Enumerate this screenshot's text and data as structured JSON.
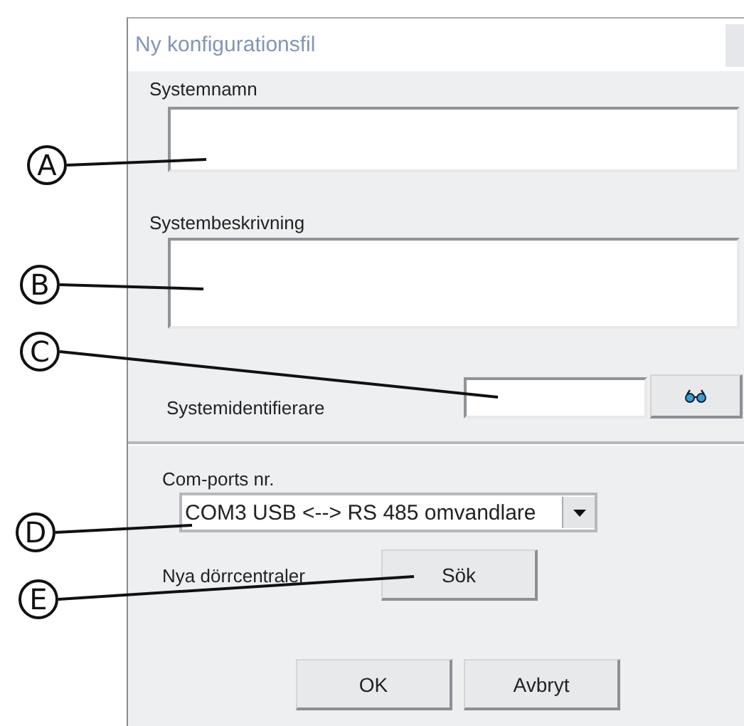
{
  "window": {
    "title": "Ny konfigurationsfil"
  },
  "fields": [
    {
      "label": "Systemnamn",
      "kind": "single"
    },
    {
      "label": "Systembeskrivning",
      "kind": "multi"
    }
  ],
  "system_id": {
    "label": "Systemidentifierare"
  },
  "com_port": {
    "label": "Com-ports nr.",
    "value": "COM3 USB <--> RS 485 omvandlare"
  },
  "search": {
    "label": "Nya dörrcentraler",
    "button": "Sök"
  },
  "buttons": [
    "OK",
    "Avbryt"
  ],
  "callouts": [
    {
      "letter": "A"
    },
    {
      "letter": "B"
    },
    {
      "letter": "C"
    },
    {
      "letter": "D"
    },
    {
      "letter": "E"
    }
  ]
}
